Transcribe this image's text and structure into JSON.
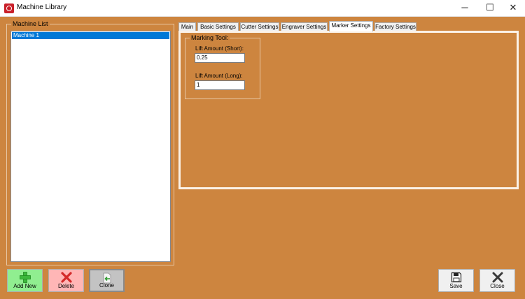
{
  "window": {
    "title": "Machine Library",
    "controls": {
      "minimize": "─",
      "maximize": "☐",
      "close": "✕"
    }
  },
  "machine_list": {
    "label": "Machine List",
    "items": [
      "Machine 1"
    ],
    "selected_index": 0,
    "selection_color": "#0078d7"
  },
  "tabs": [
    {
      "label": "Main",
      "active": false
    },
    {
      "label": "Basic Settings",
      "active": false
    },
    {
      "label": "Cutter Settings",
      "active": false
    },
    {
      "label": "Engraver Settings",
      "active": false
    },
    {
      "label": "Marker Settings",
      "active": true
    },
    {
      "label": "Factory Settings",
      "active": false
    }
  ],
  "marker_settings": {
    "group_label": "Marking Tool:",
    "lift_short_label": "Lift Amount (Short):",
    "lift_short_value": "0.25",
    "lift_long_label": "Lift Amount (Long):",
    "lift_long_value": "1"
  },
  "buttons": {
    "add_new": "Add New",
    "delete": "Delete",
    "clone": "Clone",
    "save": "Save",
    "close": "Close"
  },
  "colors": {
    "background": "#cd853f",
    "add_button": "#90ee90",
    "delete_button": "#ffb6b6",
    "clone_button": "#c3c3c3"
  },
  "icons": {
    "app": "app-logo-icon",
    "add_new": "green-plus-icon",
    "delete": "red-x-icon",
    "clone": "document-arrow-icon",
    "save": "floppy-disk-icon",
    "close": "gray-x-icon"
  }
}
